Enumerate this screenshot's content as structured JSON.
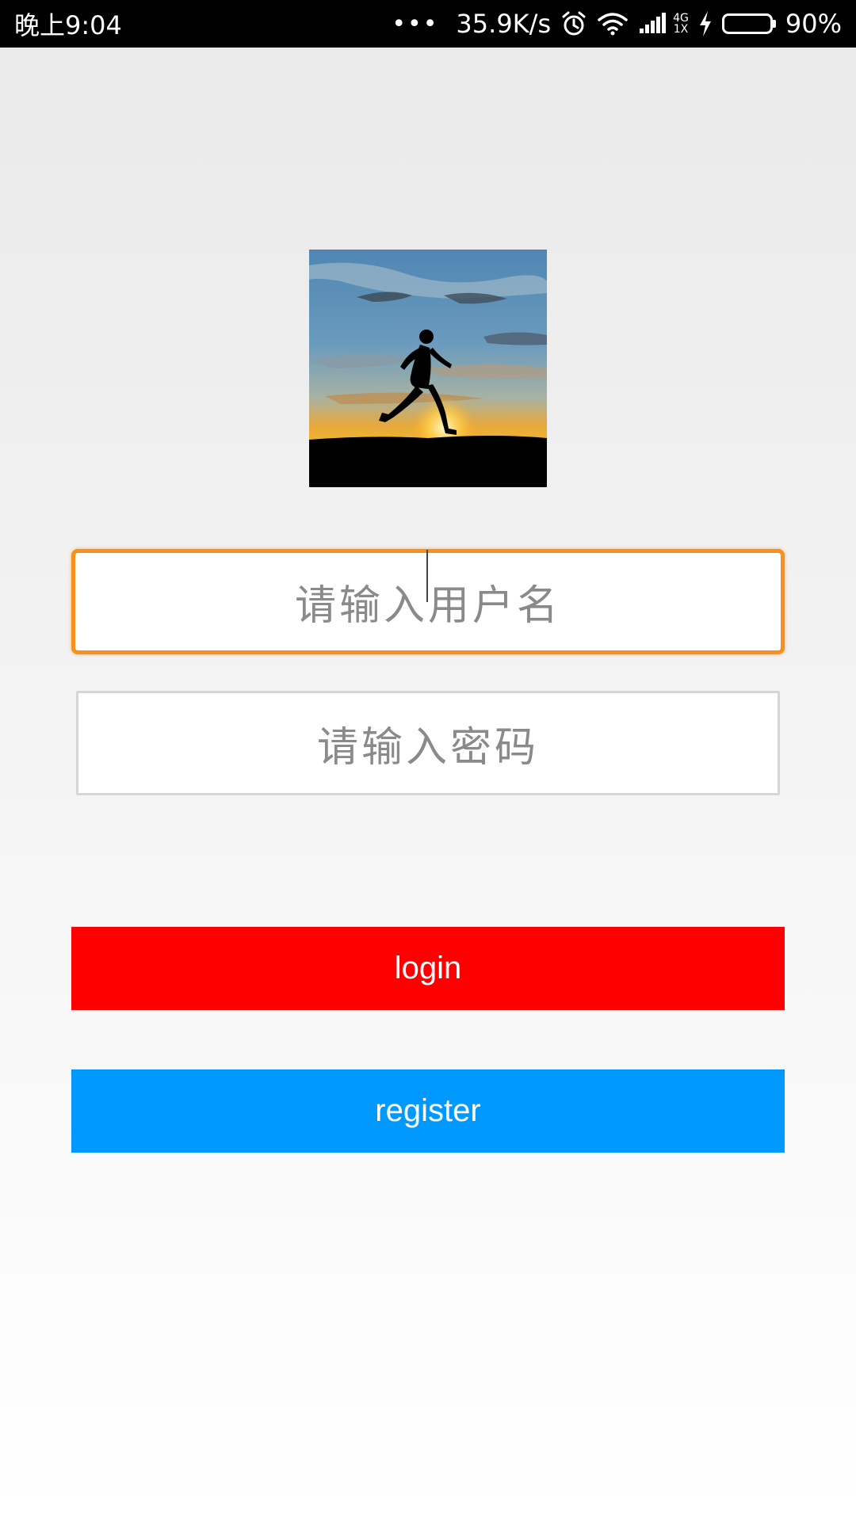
{
  "status_bar": {
    "time": "晚上9:04",
    "dots": "•••",
    "net_speed": "35.9K/s",
    "net_type_top": "4G",
    "net_type_bottom": "1X",
    "battery": "90%",
    "battery_color": "#35d915",
    "icons": [
      "alarm-icon",
      "wifi-icon",
      "signal-icon",
      "charging-icon",
      "battery-icon"
    ]
  },
  "logo": {
    "icon": "runner-sunset-image"
  },
  "form": {
    "username_placeholder": "请输入用户名",
    "password_placeholder": "请输入密码",
    "username_focus_color": "#f7901e"
  },
  "buttons": {
    "login_label": "login",
    "login_color": "#ff0000",
    "register_label": "register",
    "register_color": "#0099ff"
  }
}
